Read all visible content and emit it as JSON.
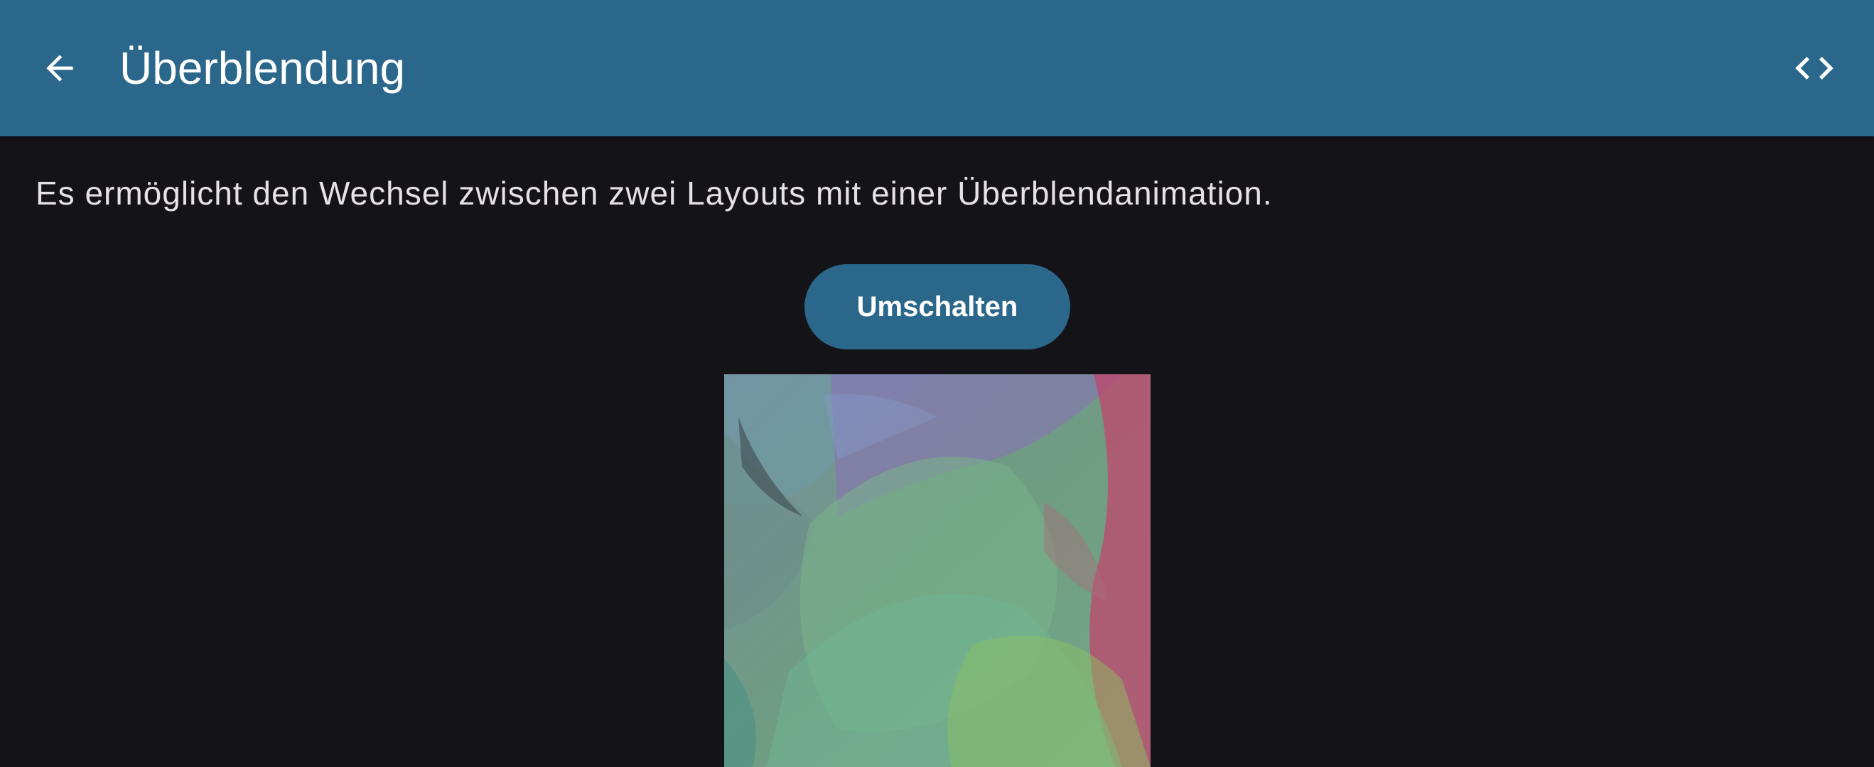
{
  "appbar": {
    "title": "Überblendung",
    "background_color": "#2b678b",
    "back_icon": "arrow-back-icon",
    "code_icon": "code-icon"
  },
  "content": {
    "description": "Es ermöglicht den Wechsel zwischen zwei Layouts mit einer Überblendanimation.",
    "toggle_button_label": "Umschalten",
    "text_color": "#e6e1e6",
    "background_color": "#141318"
  }
}
